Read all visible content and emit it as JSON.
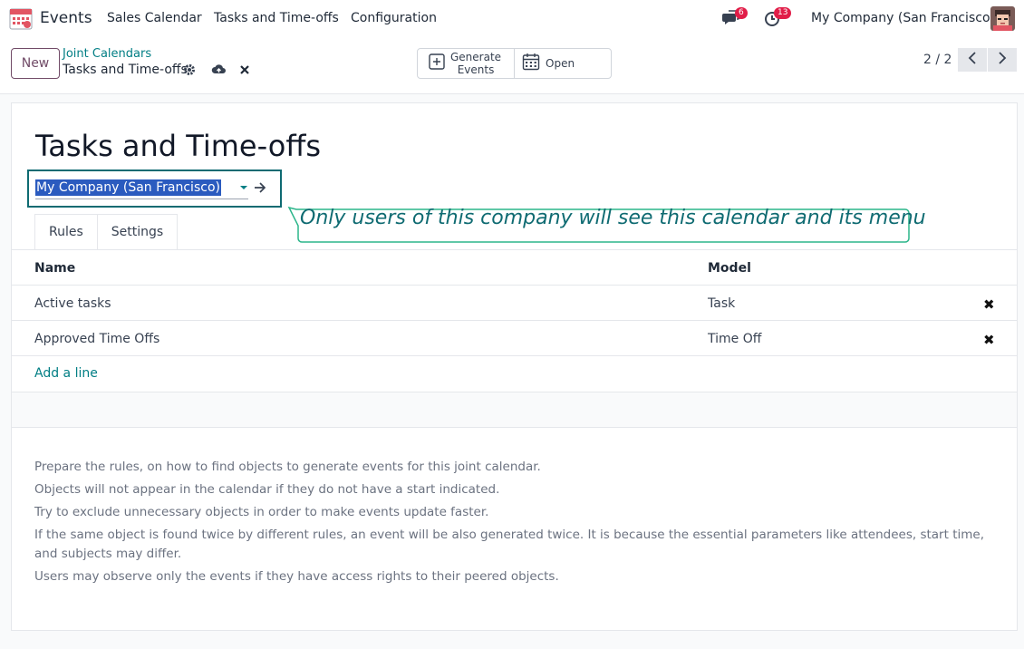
{
  "nav": {
    "app_name": "Events",
    "menu": [
      "Sales Calendar",
      "Tasks and Time-offs",
      "Configuration"
    ],
    "messages_badge": "6",
    "activities_badge": "13",
    "company": "My Company (San Francisco)",
    "app_icon": "calendar-app-icon",
    "messages_icon": "chat-icon",
    "activities_icon": "clock-icon"
  },
  "control": {
    "new_label": "New",
    "breadcrumb_parent": "Joint Calendars",
    "breadcrumb_current": "Tasks and Time-offs",
    "generate_label_1": "Generate",
    "generate_label_2": "Events",
    "open_label": "Open",
    "pager": "2 / 2"
  },
  "form": {
    "title": "Tasks and Time-offs",
    "company_value": "My Company (San Francisco)",
    "callout": "Only users of this company will see this calendar and its menu",
    "tabs": [
      "Rules",
      "Settings"
    ],
    "columns": {
      "name": "Name",
      "model": "Model"
    },
    "rows": [
      {
        "name": "Active tasks",
        "model": "Task"
      },
      {
        "name": "Approved Time Offs",
        "model": "Time Off"
      }
    ],
    "add_line": "Add a line",
    "help": [
      "Prepare the rules, on how to find objects to generate events for this joint calendar.",
      "Objects will not appear in the calendar if they do not have a start indicated.",
      "Try to exclude unnecessary objects in order to make events update faster.",
      "If the same object is found twice by different rules, an event will be also generated twice. It is because the essential parameters like attendees, start time, and subjects may differ.",
      "Users may observe only the events if they have access rights to their peered objects."
    ]
  },
  "colors": {
    "brand": "#714b67",
    "link": "#017e84",
    "callout": "#0f6b72",
    "badge": "#e11d48"
  }
}
